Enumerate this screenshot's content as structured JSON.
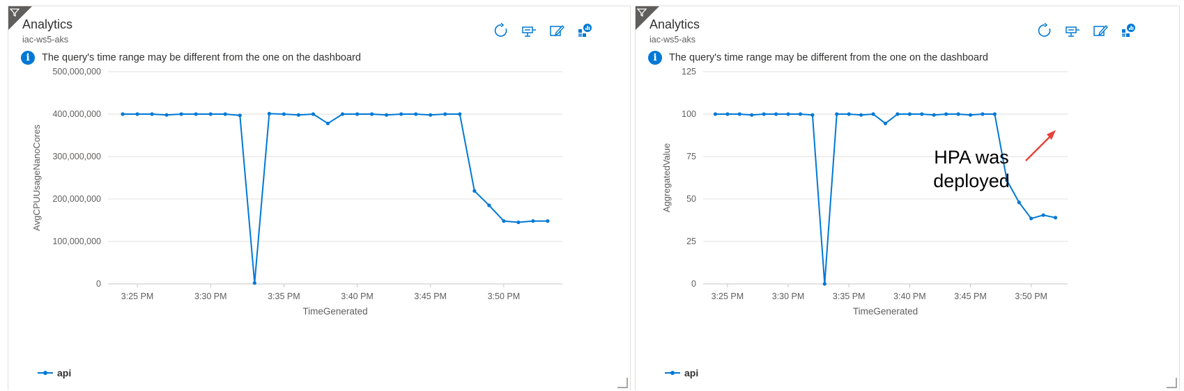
{
  "tiles": [
    {
      "title": "Analytics",
      "subtitle": "iac-ws5-aks",
      "info": "The query's time range may be different from the one on the dashboard",
      "toolbar_icons": [
        "refresh-icon",
        "pin-icon",
        "edit-icon",
        "insights-icon"
      ],
      "legend": "api",
      "annotation": ""
    },
    {
      "title": "Analytics",
      "subtitle": "iac-ws5-aks",
      "info": "The query's time range may be different from the one on the dashboard",
      "toolbar_icons": [
        "refresh-icon",
        "pin-icon",
        "edit-icon",
        "insights-icon"
      ],
      "legend": "api",
      "annotation": [
        "HPA was",
        "deployed"
      ]
    }
  ],
  "colors": {
    "series": "#0078d4",
    "info": "#0078d4",
    "grid": "#e1dfdd",
    "axis_text": "#605e5c",
    "arrow": "#e8423a"
  },
  "chart_data": [
    {
      "type": "line",
      "xlabel": "TimeGenerated",
      "ylabel": "AvgCPUUsageNanoCores",
      "xticks": [
        "3:25 PM",
        "3:30 PM",
        "3:35 PM",
        "3:40 PM",
        "3:45 PM",
        "3:50 PM"
      ],
      "yticks": [
        "0",
        "100,000,000",
        "200,000,000",
        "300,000,000",
        "400,000,000",
        "500,000,000"
      ],
      "ylim": [
        0,
        500000000
      ],
      "xlim_minutes": [
        "3:23 PM",
        "3:54 PM"
      ],
      "grid": true,
      "legend_position": "bottom-left",
      "series": [
        {
          "name": "api",
          "x": [
            "3:24 PM",
            "3:25 PM",
            "3:26 PM",
            "3:27 PM",
            "3:28 PM",
            "3:29 PM",
            "3:30 PM",
            "3:31 PM",
            "3:32 PM",
            "3:33 PM",
            "3:34 PM",
            "3:35 PM",
            "3:36 PM",
            "3:37 PM",
            "3:38 PM",
            "3:39 PM",
            "3:40 PM",
            "3:41 PM",
            "3:42 PM",
            "3:43 PM",
            "3:44 PM",
            "3:45 PM",
            "3:46 PM",
            "3:47 PM",
            "3:48 PM",
            "3:49 PM",
            "3:50 PM",
            "3:51 PM",
            "3:52 PM",
            "3:53 PM"
          ],
          "values": [
            400000000,
            400000000,
            400000000,
            398000000,
            400000000,
            400000000,
            400000000,
            400000000,
            397000000,
            2000000,
            401000000,
            400000000,
            398000000,
            400000000,
            378000000,
            400000000,
            400000000,
            400000000,
            398000000,
            400000000,
            400000000,
            398000000,
            400000000,
            400000000,
            219000000,
            185000000,
            148000000,
            145000000,
            148000000,
            148000000
          ]
        }
      ]
    },
    {
      "type": "line",
      "xlabel": "TimeGenerated",
      "ylabel": "AggregatedValue",
      "xticks": [
        "3:25 PM",
        "3:30 PM",
        "3:35 PM",
        "3:40 PM",
        "3:45 PM",
        "3:50 PM"
      ],
      "yticks": [
        "0",
        "25",
        "50",
        "75",
        "100",
        "125"
      ],
      "ylim": [
        0,
        125
      ],
      "xlim_minutes": [
        "3:23 PM",
        "3:53 PM"
      ],
      "grid": true,
      "legend_position": "bottom-left",
      "series": [
        {
          "name": "api",
          "x": [
            "3:24 PM",
            "3:25 PM",
            "3:26 PM",
            "3:27 PM",
            "3:28 PM",
            "3:29 PM",
            "3:30 PM",
            "3:31 PM",
            "3:32 PM",
            "3:33 PM",
            "3:34 PM",
            "3:35 PM",
            "3:36 PM",
            "3:37 PM",
            "3:38 PM",
            "3:39 PM",
            "3:40 PM",
            "3:41 PM",
            "3:42 PM",
            "3:43 PM",
            "3:44 PM",
            "3:45 PM",
            "3:46 PM",
            "3:47 PM",
            "3:48 PM",
            "3:49 PM",
            "3:50 PM",
            "3:51 PM",
            "3:52 PM"
          ],
          "values": [
            100,
            100,
            100,
            99.5,
            100,
            100,
            100,
            100,
            99.5,
            0,
            100,
            100,
            99.5,
            100,
            94.5,
            100,
            100,
            100,
            99.5,
            100,
            100,
            99.5,
            100,
            100,
            61,
            48,
            38.5,
            40.5,
            39
          ]
        }
      ]
    }
  ]
}
